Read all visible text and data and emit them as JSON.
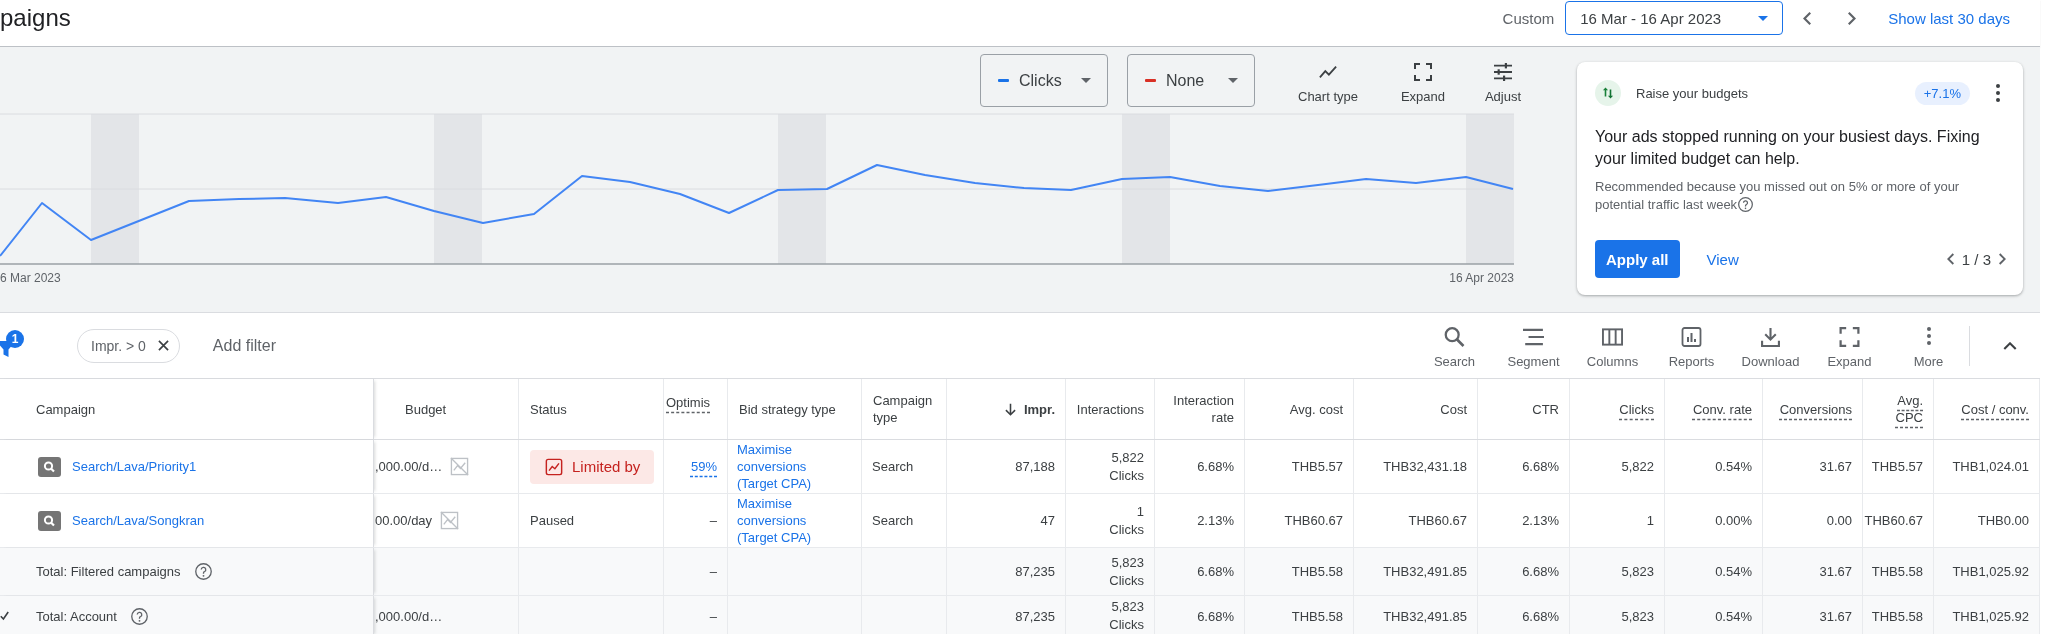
{
  "header": {
    "title": "paigns",
    "range_label": "Custom",
    "date_range": "16 Mar - 16 Apr 2023",
    "show_last_link": "Show last 30 days"
  },
  "chart": {
    "metrics": [
      {
        "label": "Clicks",
        "color": "#1a73e8"
      },
      {
        "label": "None",
        "color": "#d93025"
      }
    ],
    "tools": [
      {
        "label": "Chart type",
        "kind": "chart_type"
      },
      {
        "label": "Expand",
        "kind": "expand"
      },
      {
        "label": "Adjust",
        "kind": "adjust"
      }
    ],
    "x_start_label": "6 Mar 2023",
    "x_end_label": "16 Apr 2023"
  },
  "recommendation": {
    "title": "Raise your budgets",
    "uplift": "+7.1%",
    "headline": "Your ads stopped running on your busiest days. Fixing your limited budget can help.",
    "reason": "Recommended because you missed out on 5% or more of your potential traffic last week",
    "primary_action": "Apply all",
    "secondary_action": "View",
    "pager": "1 / 3"
  },
  "toolbar": {
    "filter_count": "1",
    "filters": [
      {
        "label": "Impr. > 0"
      }
    ],
    "add_filter": "Add filter",
    "tools": [
      {
        "label": "Search",
        "kind": "search"
      },
      {
        "label": "Segment",
        "kind": "segment"
      },
      {
        "label": "Columns",
        "kind": "columns"
      },
      {
        "label": "Reports",
        "kind": "reports"
      },
      {
        "label": "Download",
        "kind": "download"
      },
      {
        "label": "Expand",
        "kind": "expand"
      },
      {
        "label": "More",
        "kind": "more"
      }
    ]
  },
  "table": {
    "columns": [
      {
        "label": "Campaign",
        "kind": "campaign",
        "sorted": false,
        "dashed_underline": false
      },
      {
        "label": "Budget",
        "kind": "budget",
        "sorted": false,
        "dashed_underline": false
      },
      {
        "label": "Status",
        "kind": "status",
        "sorted": false,
        "dashed_underline": false
      },
      {
        "label": "Optimis",
        "kind": "score",
        "sorted": false,
        "dashed_underline": true
      },
      {
        "label": "Bid strategy type",
        "kind": "bid_strategy",
        "sorted": false,
        "dashed_underline": false
      },
      {
        "label": "Campaign type",
        "kind": "text",
        "sorted": false,
        "dashed_underline": false
      },
      {
        "label": "Impr.",
        "kind": "number",
        "sorted": true,
        "dashed_underline": false
      },
      {
        "label": "Interactions",
        "kind": "interactions",
        "sorted": false,
        "dashed_underline": false
      },
      {
        "label": "Interaction rate",
        "kind": "number",
        "sorted": false,
        "dashed_underline": false
      },
      {
        "label": "Avg. cost",
        "kind": "number",
        "sorted": false,
        "dashed_underline": false
      },
      {
        "label": "Cost",
        "kind": "number",
        "sorted": false,
        "dashed_underline": false
      },
      {
        "label": "CTR",
        "kind": "number",
        "sorted": false,
        "dashed_underline": false
      },
      {
        "label": "Clicks",
        "kind": "number",
        "sorted": false,
        "dashed_underline": true
      },
      {
        "label": "Conv. rate",
        "kind": "number",
        "sorted": false,
        "dashed_underline": true
      },
      {
        "label": "Conversions",
        "kind": "number",
        "sorted": false,
        "dashed_underline": true
      },
      {
        "label": "Avg. CPC",
        "kind": "number",
        "sorted": false,
        "dashed_underline": true
      },
      {
        "label": "Cost / conv.",
        "kind": "number",
        "sorted": false,
        "dashed_underline": true
      }
    ],
    "rows": [
      {
        "kind": "campaign",
        "checked": false,
        "cells": [
          "Search/Lava/Priority1",
          ",000.00/d…",
          {
            "text": "Limited by",
            "kind": "limited"
          },
          {
            "text": "59%",
            "kind": "link"
          },
          "Maximise conversions (Target CPA)",
          "Search",
          "87,188",
          {
            "value": "5,822",
            "unit": "Clicks"
          },
          "6.68%",
          "THB5.57",
          "THB32,431.18",
          "6.68%",
          "5,822",
          "0.54%",
          "31.67",
          "THB5.57",
          "THB1,024.01"
        ]
      },
      {
        "kind": "campaign",
        "checked": false,
        "cells": [
          "Search/Lava/Songkran",
          "00.00/day",
          {
            "text": "Paused",
            "kind": "paused"
          },
          "–",
          "Maximise conversions (Target CPA)",
          "Search",
          "47",
          {
            "value": "1",
            "unit": "Clicks"
          },
          "2.13%",
          "THB60.67",
          "THB60.67",
          "2.13%",
          "1",
          "0.00%",
          "0.00",
          "THB60.67",
          "THB0.00"
        ]
      },
      {
        "kind": "total",
        "checked": false,
        "cells": [
          "Total: Filtered campaigns",
          null,
          null,
          "–",
          null,
          null,
          "87,235",
          {
            "value": "5,823",
            "unit": "Clicks"
          },
          "6.68%",
          "THB5.58",
          "THB32,491.85",
          "6.68%",
          "5,823",
          "0.54%",
          "31.67",
          "THB5.58",
          "THB1,025.92"
        ]
      },
      {
        "kind": "total",
        "checked": true,
        "cells": [
          "Total: Account",
          ",000.00/d…",
          null,
          "–",
          null,
          null,
          "87,235",
          {
            "value": "5,823",
            "unit": "Clicks"
          },
          "6.68%",
          "THB5.58",
          "THB32,491.85",
          "6.68%",
          "5,823",
          "0.54%",
          "31.67",
          "THB5.58",
          "THB1,025.92"
        ]
      }
    ]
  }
}
